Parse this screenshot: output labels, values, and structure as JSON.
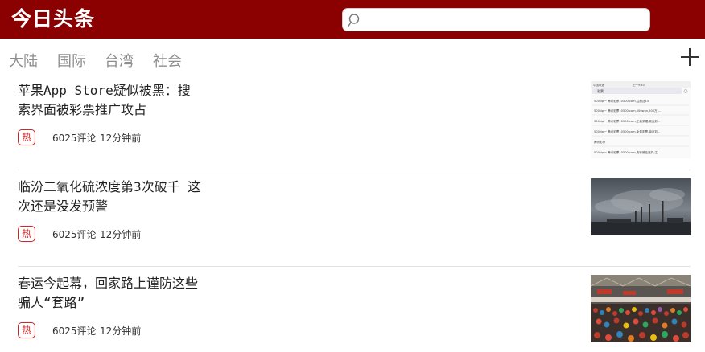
{
  "header": {
    "logo": "今日头条",
    "search_placeholder": ""
  },
  "tabs": [
    "大陆",
    "国际",
    "台湾",
    "社会"
  ],
  "articles": [
    {
      "title": "苹果App Store疑似被黑：搜索界面被彩票推广攻占",
      "hot": "热",
      "comments": "6025评论",
      "time": "12分钟前",
      "thumb_lines": [
        "中国联通",
        "上午9:40",
        "彩票",
        "500vip一 腾讯彩票10500.com,注册送15",
        "500vip一 腾讯彩票10500.com,500wan,500万,...",
        "500vip一 腾讯彩票10500.com,王者荣耀,奥运彩...",
        "500vip一 腾讯彩票10500.com,免费彩票,南京彩...",
        "腾讯彩票",
        "500vip一 腾讯彩票10500.com,购彩最佳选择,注..."
      ]
    },
    {
      "title": "临汾二氧化硫浓度第3次破千 这次还是没发预警",
      "hot": "热",
      "comments": "6025评论",
      "time": "12分钟前"
    },
    {
      "title": "春运今起幕，回家路上谨防这些骗人“套路”",
      "hot": "热",
      "comments": "6025评论",
      "time": "12分钟前"
    }
  ],
  "colors": {
    "brand": "#8b0000",
    "hot": "#d42020"
  }
}
